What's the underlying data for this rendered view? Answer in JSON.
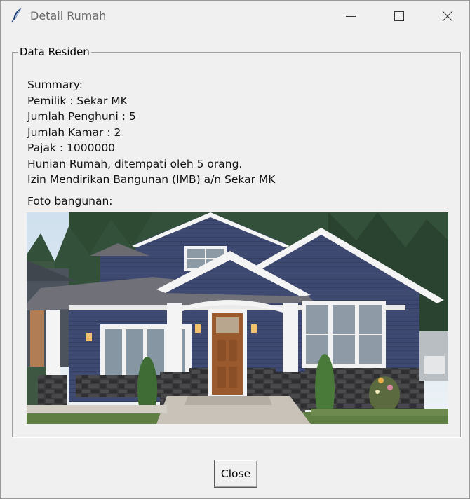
{
  "window": {
    "title": "Detail Rumah"
  },
  "group": {
    "legend": "Data Residen",
    "lines": [
      "Summary:",
      "Pemilik : Sekar MK",
      "Jumlah Penghuni : 5",
      "Jumlah Kamar : 2",
      "Pajak : 1000000",
      "Hunian Rumah, ditempati oleh 5 orang.",
      "Izin Mendirikan Bangunan (IMB) a/n Sekar MK"
    ],
    "photo_label": "Foto bangunan:"
  },
  "buttons": {
    "close_label": "Close"
  },
  "icons": {
    "app": "feather-icon",
    "minimize": "minimize-icon",
    "maximize": "maximize-icon",
    "close": "close-icon"
  }
}
